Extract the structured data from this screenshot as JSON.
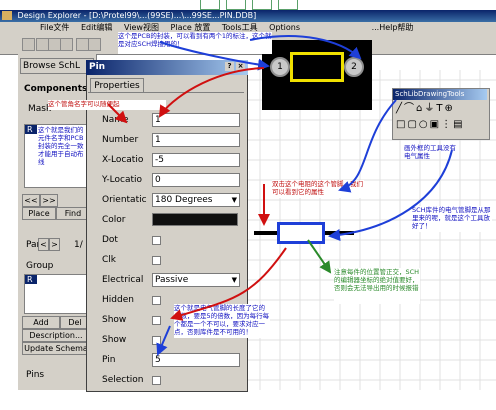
{
  "window": {
    "title": "Design Explorer - [D:\\Protel99\\...(99SE)...\\...99SE...PIN.DDB]"
  },
  "menu": {
    "items": [
      "File文件",
      "Edit编辑",
      "View视图",
      "Place 放置",
      "Tools工具",
      "Options",
      "...Help帮助"
    ]
  },
  "left_panel": {
    "tab_label": "Browse SchL",
    "components_label": "Components",
    "mask_label": "Mask",
    "component_item": "R",
    "nav_buttons": [
      "<<",
      ">>",
      "<",
      ">"
    ],
    "place_button": "Place",
    "find_button": "Find",
    "part_label": "Part",
    "part_value": "1/",
    "group_label": "Group",
    "group_item": "R",
    "add_button": "Add",
    "del_button": "Del",
    "description_button": "Description...",
    "update_button": "Update Schema",
    "pins_label": "Pins"
  },
  "pin_dialog": {
    "title": "Pin",
    "tab": "Properties",
    "fields": {
      "name_label": "Name",
      "name_value": "1",
      "number_label": "Number",
      "number_value": "1",
      "xloc_label": "X-Locatio",
      "xloc_value": "-5",
      "yloc_label": "Y-Locatio",
      "yloc_value": "0",
      "orient_label": "Orientatic",
      "orient_value": "180 Degrees",
      "color_label": "Color",
      "color_value": "#101010",
      "dot_label": "Dot",
      "clk_label": "Clk",
      "electrical_label": "Electrical",
      "electrical_value": "Passive",
      "hidden_label": "Hidden",
      "show_label": "Show",
      "show2_label": "Show",
      "pin_label": "Pin",
      "pin_value": "5",
      "selection_label": "Selection"
    }
  },
  "toolbox": {
    "title": "SchLibDrawingTools"
  },
  "canvas": {
    "pin1_label": "1",
    "pin2_label": "2"
  },
  "annotations": {
    "top_note": "这个是PCB的封装，可以看到有两个1的标注，这个就是对应SCH焊接用的！",
    "left_note": "这个管角名字可以随便起",
    "list_note": "这个就是我们的元件名字和PCB封装的完全一致才能用于自动布线",
    "mid_red_note": "双击这个电阻的这个管脚，我们可以看到它的属性",
    "toolbox_note": "画外框的工具没有电气属性",
    "right_note": "SCH库件的电气管脚是从那里来的呢，就是这个工具放好了！",
    "green_note": "注意每件的位置管正交，SCH的编辑器坐标的绝对值要好，否则会无法导出用的时候报错",
    "bottom_note": "这个就是电气管脚的长度了它的参数，要是5的倍数，因为每行每个都是一个不可以，要求对应一点，否则库件是不可用的！"
  },
  "colors": {
    "annotation_red": "#d01010",
    "annotation_blue": "#1e3fd8",
    "annotation_green": "#2a8a2a",
    "pcb_outline": "#f0e000",
    "pcb_background": "#000000"
  }
}
